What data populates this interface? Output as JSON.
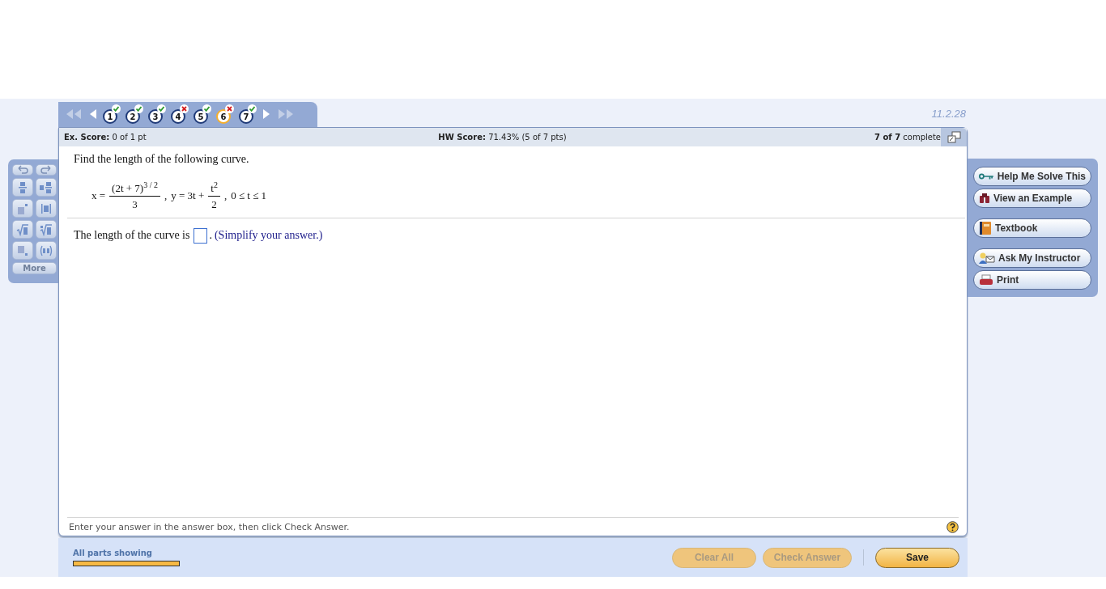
{
  "navigation": {
    "questions": [
      {
        "label": "1",
        "correct": true,
        "selected": false
      },
      {
        "label": "2",
        "correct": true,
        "selected": false
      },
      {
        "label": "3",
        "correct": true,
        "selected": false
      },
      {
        "label": "4",
        "correct": false,
        "selected": false
      },
      {
        "label": "5",
        "correct": true,
        "selected": false
      },
      {
        "label": "6",
        "correct": false,
        "selected": true
      },
      {
        "label": "7",
        "correct": true,
        "selected": false
      }
    ]
  },
  "version": "11.2.28",
  "header": {
    "ex_score": {
      "label": "Ex. Score:",
      "value": "0 of 1 pt"
    },
    "hw_score": {
      "label": "HW Score:",
      "value": "71.43% (5 of 7 pts)"
    },
    "progress": {
      "count": "7 of 7",
      "label": "complete"
    }
  },
  "math_palette": {
    "more": "More"
  },
  "question": {
    "prompt": "Find the length of the following curve.",
    "formula": {
      "x_lhs": "x =",
      "x_num": "(2t + 7)",
      "x_exp": "3 / 2",
      "x_den": "3",
      "sep1": ",",
      "y_lhs": "y = 3t +",
      "y_num": "t",
      "y_exp": "2",
      "y_den": "2",
      "sep2": ",",
      "range": "0 ≤ t ≤ 1"
    },
    "answer_lead": "The length of the curve is",
    "answer_tail": ".",
    "hint": "(Simplify your answer.)"
  },
  "instructions": "Enter your answer in the answer box, then click Check Answer.",
  "help_tools": [
    {
      "kind": "key",
      "label": "Help Me Solve This"
    },
    {
      "kind": "example",
      "label": "View an Example"
    },
    {
      "kind": "book",
      "label": "Textbook"
    },
    {
      "kind": "instructor",
      "label": "Ask My Instructor"
    },
    {
      "kind": "print",
      "label": "Print"
    }
  ],
  "parts": {
    "label": "All parts showing",
    "level": 1
  },
  "buttons": [
    {
      "label": "Clear All",
      "disabled": true
    },
    {
      "label": "Check Answer",
      "disabled": true
    },
    {
      "label": "Save",
      "disabled": false
    }
  ]
}
